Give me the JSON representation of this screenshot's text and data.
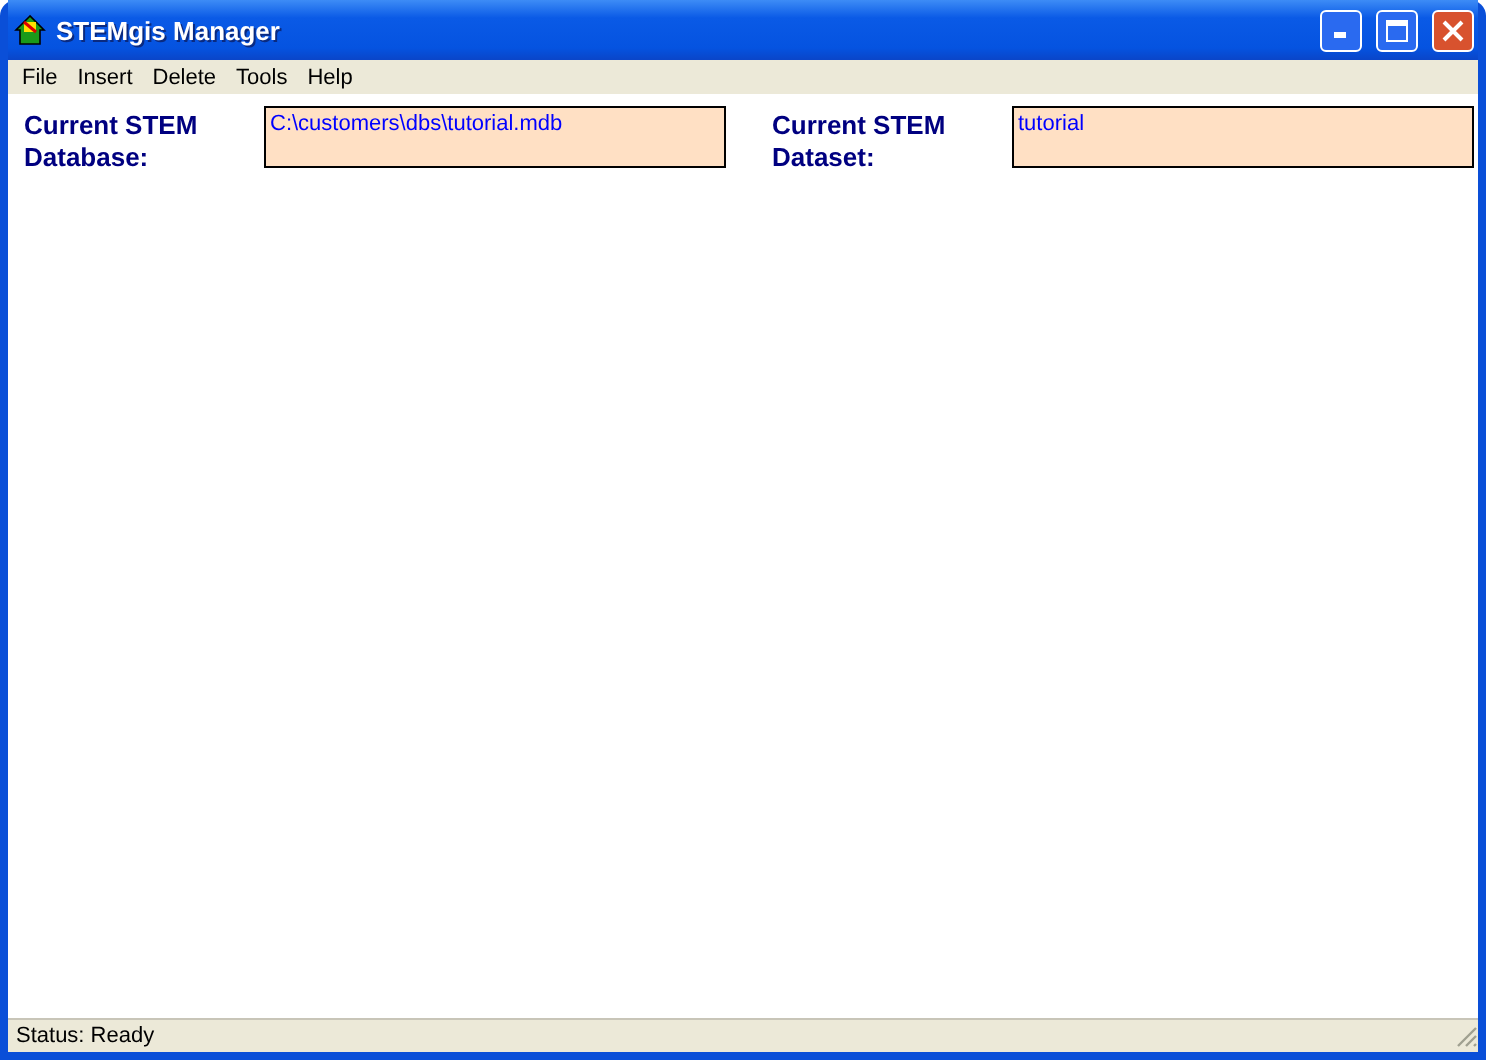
{
  "window": {
    "title": "STEMgis Manager"
  },
  "menu": [
    "File",
    "Insert",
    "Delete",
    "Tools",
    "Help"
  ],
  "fields": [
    {
      "label": "Current STEM Database:",
      "value": "C:\\customers\\dbs\\tutorial.mdb"
    },
    {
      "label": "Current STEM Dataset:",
      "value": "tutorial"
    }
  ],
  "status_bar": "Status: Ready"
}
